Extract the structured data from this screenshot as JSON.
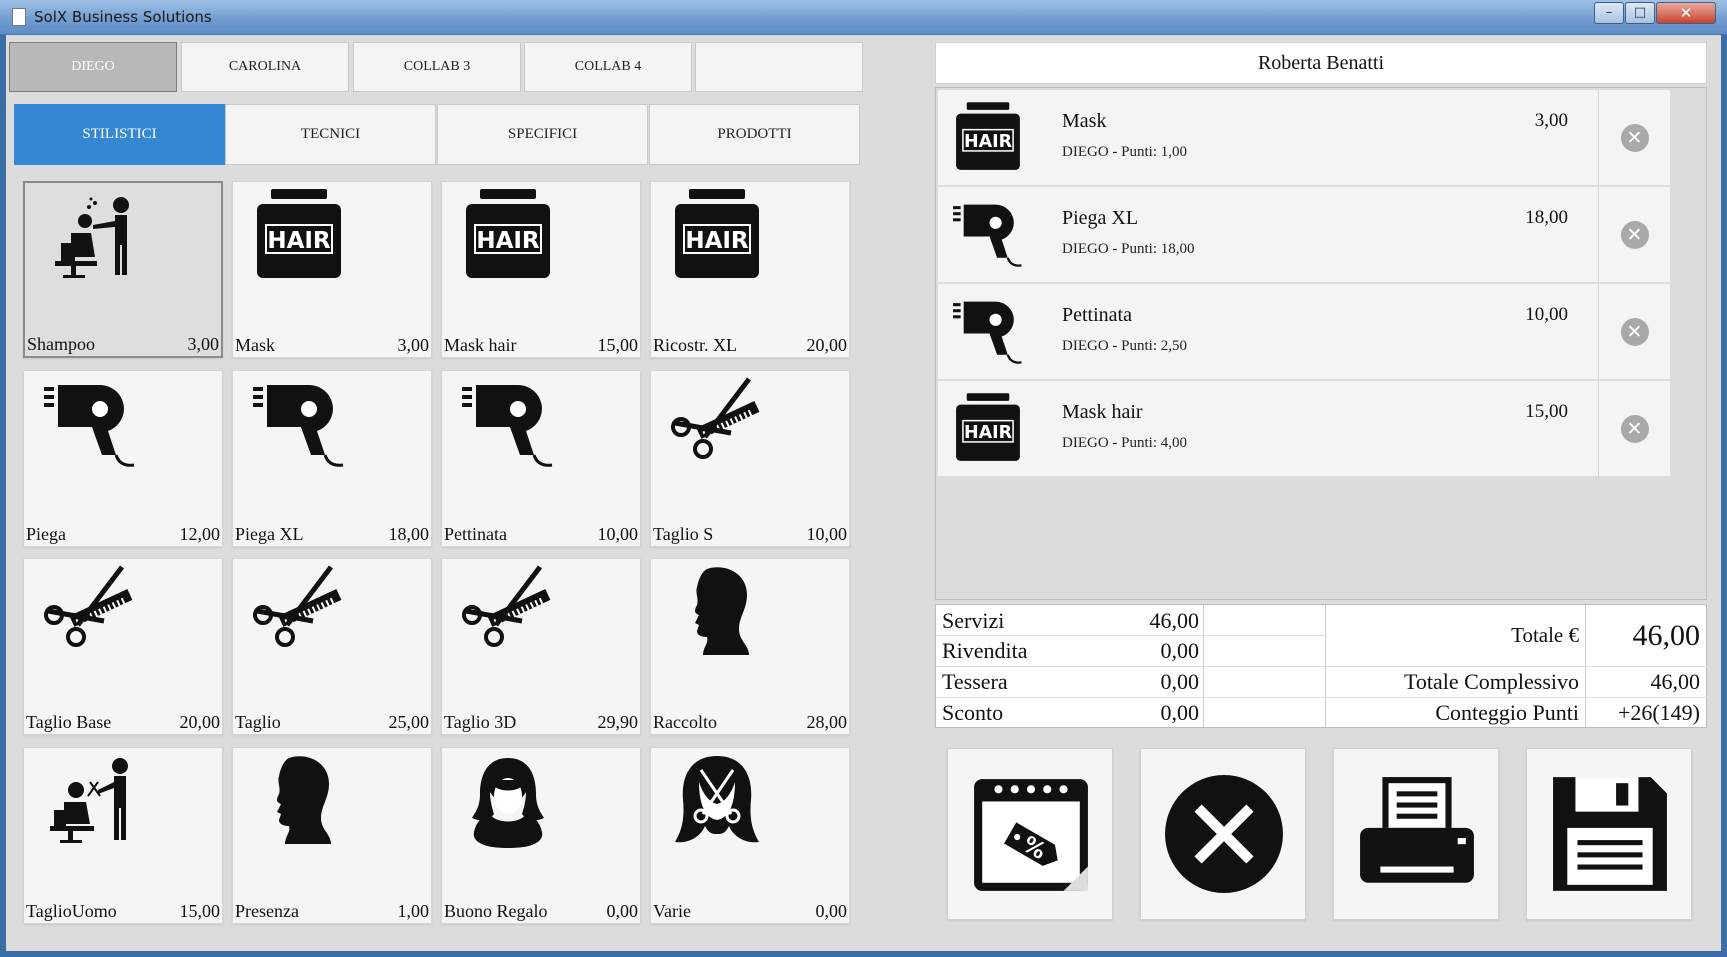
{
  "window": {
    "title": "SolX Business Solutions",
    "buttons": [
      "–",
      "□",
      "✕"
    ]
  },
  "staff_tabs": [
    {
      "label": "DIEGO",
      "active": true
    },
    {
      "label": "CAROLINA",
      "active": false
    },
    {
      "label": "COLLAB 3",
      "active": false
    },
    {
      "label": "COLLAB 4",
      "active": false
    },
    {
      "label": "",
      "active": false
    }
  ],
  "category_tabs": [
    {
      "label": "STILISTICI",
      "active": true
    },
    {
      "label": "TECNICI",
      "active": false
    },
    {
      "label": "SPECIFICI",
      "active": false
    },
    {
      "label": "PRODOTTI",
      "active": false
    }
  ],
  "services": [
    {
      "name": "Shampoo",
      "price": "3,00",
      "icon": "shampoo-chair-icon",
      "selected": true
    },
    {
      "name": "Mask",
      "price": "3,00",
      "icon": "hair-jar-icon"
    },
    {
      "name": "Mask hair",
      "price": "15,00",
      "icon": "hair-jar-icon"
    },
    {
      "name": "Ricostr. XL",
      "price": "20,00",
      "icon": "hair-jar-icon"
    },
    {
      "name": "Piega",
      "price": "12,00",
      "icon": "hair-dryer-icon"
    },
    {
      "name": "Piega XL",
      "price": "18,00",
      "icon": "hair-dryer-icon"
    },
    {
      "name": "Pettinata",
      "price": "10,00",
      "icon": "hair-dryer-icon"
    },
    {
      "name": "Taglio S",
      "price": "10,00",
      "icon": "scissors-comb-icon"
    },
    {
      "name": "Taglio Base",
      "price": "20,00",
      "icon": "scissors-comb-icon"
    },
    {
      "name": "Taglio",
      "price": "25,00",
      "icon": "scissors-comb-icon"
    },
    {
      "name": "Taglio 3D",
      "price": "29,90",
      "icon": "scissors-comb-icon"
    },
    {
      "name": "Raccolto",
      "price": "28,00",
      "icon": "woman-profile-icon"
    },
    {
      "name": "TaglioUomo",
      "price": "15,00",
      "icon": "barber-chair-icon"
    },
    {
      "name": "Presenza",
      "price": "1,00",
      "icon": "woman-profile-icon"
    },
    {
      "name": "Buono Regalo",
      "price": "0,00",
      "icon": "woman-avatar-icon"
    },
    {
      "name": "Varie",
      "price": "0,00",
      "icon": "hair-cut-icon"
    }
  ],
  "client": {
    "name": "Roberta Benatti"
  },
  "cart": [
    {
      "name": "Mask",
      "detail": "DIEGO - Punti: 1,00",
      "price": "3,00",
      "icon": "hair-jar-icon"
    },
    {
      "name": "Piega XL",
      "detail": "DIEGO - Punti: 18,00",
      "price": "18,00",
      "icon": "hair-dryer-icon"
    },
    {
      "name": "Pettinata",
      "detail": "DIEGO - Punti: 2,50",
      "price": "10,00",
      "icon": "hair-dryer-icon"
    },
    {
      "name": "Mask hair",
      "detail": "DIEGO - Punti: 4,00",
      "price": "15,00",
      "icon": "hair-jar-icon"
    }
  ],
  "totals": {
    "servizi_label": "Servizi",
    "servizi_value": "46,00",
    "rivendita_label": "Rivendita",
    "rivendita_value": "0,00",
    "tessera_label": "Tessera",
    "tessera_value": "0,00",
    "sconto_label": "Sconto",
    "sconto_value": "0,00",
    "totale_label": "Totale €",
    "totale_value": "46,00",
    "complessivo_label": "Totale Complessivo",
    "complessivo_value": "46,00",
    "punti_label": "Conteggio Punti",
    "punti_value": "+26(149)"
  },
  "actions": [
    {
      "name": "discount-calendar-button",
      "icon": "calendar-discount-icon"
    },
    {
      "name": "cancel-button",
      "icon": "close-circle-icon"
    },
    {
      "name": "print-button",
      "icon": "printer-icon"
    },
    {
      "name": "save-button",
      "icon": "floppy-disk-icon"
    }
  ],
  "colors": {
    "accent": "#3487d3",
    "background": "#dcdcdc",
    "tile": "#f5f5f5"
  }
}
